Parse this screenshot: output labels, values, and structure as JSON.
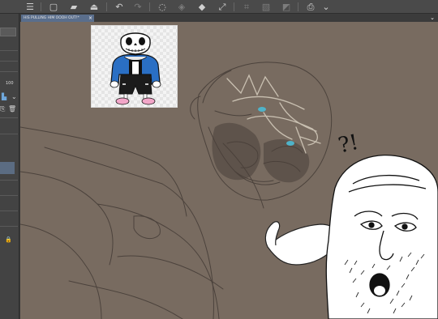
{
  "toolbar": {
    "buttons": [
      {
        "name": "menu-icon",
        "glyph": "☰"
      },
      {
        "name": "new-file-icon",
        "glyph": "▢"
      },
      {
        "name": "open-folder-icon",
        "glyph": "▰"
      },
      {
        "name": "save-icon",
        "glyph": "⏏"
      },
      {
        "name": "undo-icon",
        "glyph": "↶"
      },
      {
        "name": "redo-icon",
        "glyph": "↷"
      },
      {
        "name": "lasso-icon",
        "glyph": "◌"
      },
      {
        "name": "clear-selection-icon",
        "glyph": "◈"
      },
      {
        "name": "fill-icon",
        "glyph": "◆"
      },
      {
        "name": "transform-icon",
        "glyph": "⤢"
      },
      {
        "name": "crop-icon",
        "glyph": "⌗"
      },
      {
        "name": "ruler-icon",
        "glyph": "▧"
      },
      {
        "name": "tone-icon",
        "glyph": "◩"
      },
      {
        "name": "frame-icon",
        "glyph": "▣"
      },
      {
        "name": "print-icon",
        "glyph": "⎙"
      },
      {
        "name": "chevron-down-icon",
        "glyph": "⌄"
      }
    ]
  },
  "tab": {
    "title": "HIS PULLING HIM OOOH OUT!*",
    "close_glyph": "×",
    "menu_glyph": "⌄"
  },
  "left_panel": {
    "opacity_value": "100",
    "lock_glyph": "🔒",
    "trash_glyph": "🗑",
    "copy_glyph": "⎘"
  },
  "canvas": {
    "background": "#786b60",
    "annotation": "?!"
  }
}
